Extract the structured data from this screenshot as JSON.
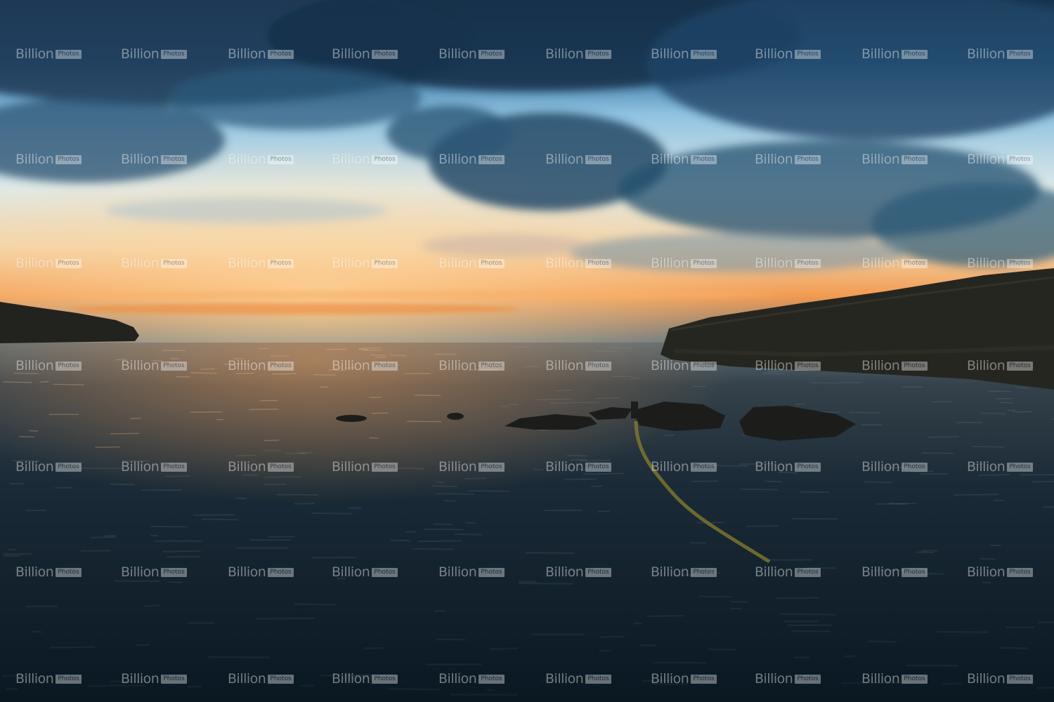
{
  "image": {
    "subject": "sunset over a calm sea bay with rocky headlands and rocks in the water",
    "palette": {
      "sky_top": "#1e4a6e",
      "sky_blue": "#3f8fc4",
      "sky_light": "#cfe3ee",
      "horizon_orange": "#f09a4a",
      "sea_dark": "#0e2230",
      "cliff": "#1f2220"
    }
  },
  "watermark": {
    "brand": "Billion",
    "tag": "Photos"
  }
}
